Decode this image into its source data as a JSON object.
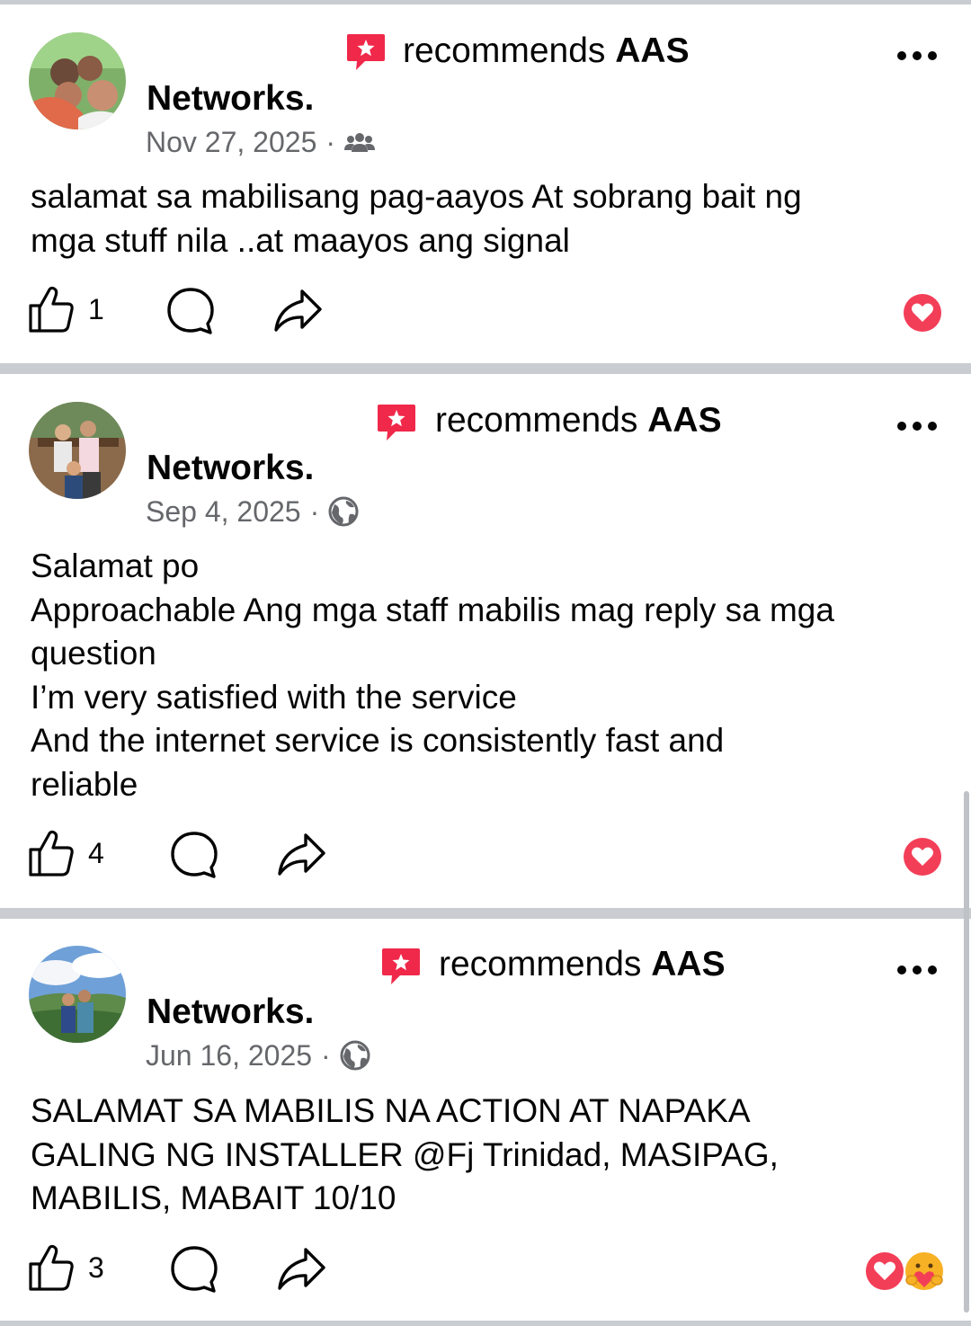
{
  "posts": [
    {
      "recommend_text": "recommends",
      "page_bold": "AAS",
      "page_name_line2": "Networks.",
      "date": "Nov 27, 2025",
      "privacy": "friends-icon",
      "body": "salamat sa mabilisang pag-aayos At sobrang bait ng\nmga stuff nila ..at maayos ang signal",
      "like_count": "1",
      "reactions": [
        "love"
      ]
    },
    {
      "recommend_text": "recommends",
      "page_bold": "AAS",
      "page_name_line2": "Networks.",
      "date": "Sep 4, 2025",
      "privacy": "globe-icon",
      "body": "Salamat po\nApproachable Ang mga staff mabilis mag reply sa mga\nquestion\nI’m very satisfied with the service\nAnd the internet service is consistently fast and\nreliable",
      "like_count": "4",
      "reactions": [
        "love"
      ]
    },
    {
      "recommend_text": "recommends",
      "page_bold": "AAS",
      "page_name_line2": "Networks.",
      "date": "Jun 16, 2025",
      "privacy": "globe-icon",
      "body": "SALAMAT SA MABILIS NA ACTION AT NAPAKA\nGALING NG INSTALLER @Fj Trinidad, MASIPAG,\nMABILIS, MABAIT 10/10",
      "like_count": "3",
      "reactions": [
        "love",
        "care"
      ]
    }
  ],
  "colors": {
    "recommend_badge": "#f0284a",
    "love": "#f33e58",
    "meta_text": "#65676b",
    "separator": "#c9ccd1"
  }
}
